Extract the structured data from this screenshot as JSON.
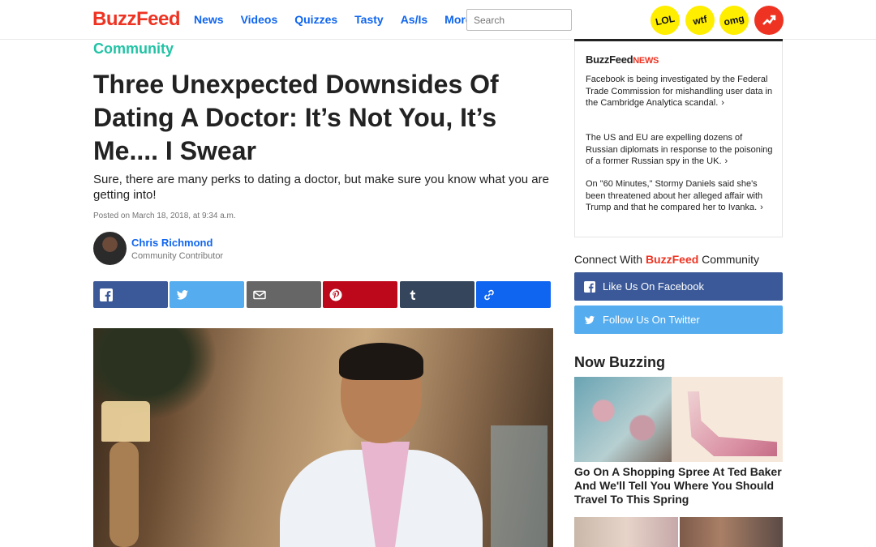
{
  "header": {
    "logo": "BuzzFeed",
    "nav": [
      "News",
      "Videos",
      "Quizzes",
      "Tasty",
      "As/Is",
      "More"
    ],
    "search_placeholder": "Search",
    "badges": [
      "LOL",
      "wtf",
      "omg"
    ]
  },
  "article": {
    "category": "Community",
    "headline": "Three Unexpected Downsides Of Dating A Doctor: It’s Not You, It’s Me.... I Swear",
    "dek": "Sure, there are many perks to dating a doctor, but make sure you know what you are getting into!",
    "posted": "Posted on March 18, 2018, at 9:34 a.m.",
    "author_name": "Chris Richmond",
    "author_role": "Community Contributor"
  },
  "share": {
    "buttons": [
      {
        "icon": "facebook-icon",
        "color": "#3b5998"
      },
      {
        "icon": "twitter-icon",
        "color": "#55acee"
      },
      {
        "icon": "email-icon",
        "color": "#666666"
      },
      {
        "icon": "pinterest-icon",
        "color": "#bd081c"
      },
      {
        "icon": "tumblr-icon",
        "color": "#35465c"
      },
      {
        "icon": "link-icon",
        "color": "#0f65ef"
      }
    ]
  },
  "sidebar": {
    "news_logo": "BuzzFeed",
    "news_logo_suffix": "NEWS",
    "news_items": [
      "Facebook is being investigated by the Federal Trade Commission for mishandling user data in the Cambridge Analytica scandal.",
      "The US and EU are expelling dozens of Russian diplomats in response to the poisoning of a former Russian spy in the UK.",
      "On \"60 Minutes,\" Stormy Daniels said she's been threatened about her alleged affair with Trump and that he compared her to Ivanka."
    ],
    "connect_prefix": "Connect With",
    "connect_brand": "BuzzFeed",
    "connect_suffix": "Community",
    "facebook_label": "Like Us On Facebook",
    "twitter_label": "Follow Us On Twitter",
    "now_buzzing_title": "Now Buzzing",
    "buzz_caption": "Go On A Shopping Spree At Ted Baker And We'll Tell You Where You Should Travel To This Spring"
  },
  "colors": {
    "brand_red": "#ee3322",
    "link_blue": "#0f65ef",
    "community_green": "#21c3a5",
    "facebook_blue": "#3b5998",
    "twitter_blue": "#55acee",
    "badge_yellow": "#ffee00"
  }
}
